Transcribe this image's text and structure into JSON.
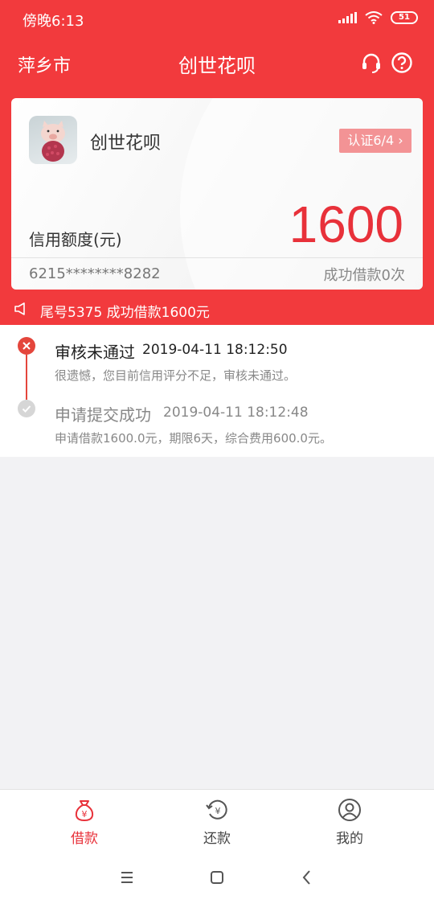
{
  "status_bar": {
    "time": "傍晚6:13",
    "battery": "51"
  },
  "header": {
    "city": "萍乡市",
    "title": "创世花呗",
    "icons": [
      "headset-icon",
      "help-icon"
    ]
  },
  "card": {
    "name": "创世花呗",
    "verify": "认证6/4",
    "credit_label": "信用额度(元)",
    "credit_amount": "1600",
    "card_number": "6215********8282",
    "borrow_count": "成功借款0次"
  },
  "notice": {
    "text": "尾号5375 成功借款1600元",
    "icon": "speaker-icon"
  },
  "timeline": [
    {
      "title": "审核未通过",
      "time": "2019-04-11 18:12:50",
      "desc": "很遗憾，您目前信用评分不足，审核未通过。",
      "icon": "close-icon"
    },
    {
      "title": "申请提交成功",
      "time": "2019-04-11 18:12:48",
      "desc": "申请借款1600.0元，期限6天，综合费用600.0元。",
      "icon": "check-icon"
    }
  ],
  "tabs": [
    {
      "label": "借款",
      "icon": "money-bag-icon",
      "active": true
    },
    {
      "label": "还款",
      "icon": "repay-icon",
      "active": false
    },
    {
      "label": "我的",
      "icon": "user-icon",
      "active": false
    }
  ],
  "colors": {
    "brand": "#f23a3d",
    "amount": "#e8313a",
    "verify_bg": "#f39395"
  }
}
